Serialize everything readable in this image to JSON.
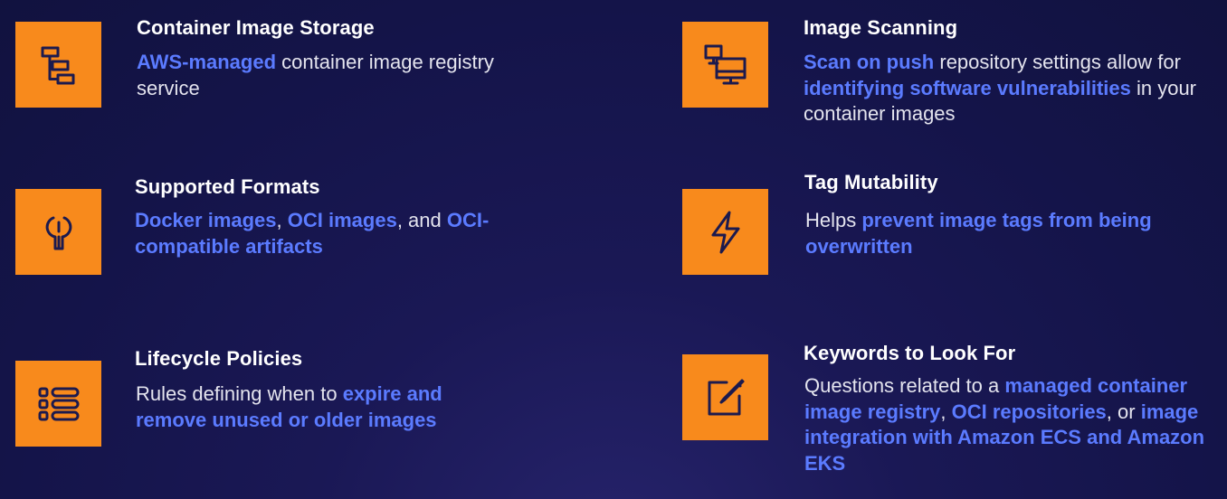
{
  "accent_color": "#5b7bff",
  "icon_bg_color": "#f88a1c",
  "features": [
    {
      "id": "container-image-storage",
      "icon": "registry-icon",
      "title": "Container Image Storage",
      "desc": [
        {
          "t": "AWS-managed",
          "hl": true
        },
        {
          "t": " container image registry service",
          "hl": false
        }
      ]
    },
    {
      "id": "image-scanning",
      "icon": "monitor-scan-icon",
      "title": "Image Scanning",
      "desc": [
        {
          "t": "Scan on push",
          "hl": true
        },
        {
          "t": " repository settings allow for ",
          "hl": false
        },
        {
          "t": "identifying software vulnerabilities",
          "hl": true
        },
        {
          "t": " in your container images",
          "hl": false
        }
      ]
    },
    {
      "id": "supported-formats",
      "icon": "wrench-icon",
      "title": "Supported Formats",
      "desc": [
        {
          "t": "Docker images",
          "hl": true
        },
        {
          "t": ", ",
          "hl": false
        },
        {
          "t": "OCI images",
          "hl": true
        },
        {
          "t": ", and ",
          "hl": false
        },
        {
          "t": "OCI-compatible artifacts",
          "hl": true
        }
      ]
    },
    {
      "id": "tag-mutability",
      "icon": "lightning-icon",
      "title": "Tag Mutability",
      "desc": [
        {
          "t": "Helps ",
          "hl": false
        },
        {
          "t": "prevent image tags from being overwritten",
          "hl": true
        }
      ]
    },
    {
      "id": "lifecycle-policies",
      "icon": "list-icon",
      "title": "Lifecycle Policies",
      "desc": [
        {
          "t": "Rules defining when to ",
          "hl": false
        },
        {
          "t": "expire and remove unused or older images",
          "hl": true
        }
      ]
    },
    {
      "id": "keywords",
      "icon": "edit-icon",
      "title": "Keywords to Look For",
      "desc": [
        {
          "t": "Questions related to a ",
          "hl": false
        },
        {
          "t": "managed container image registry",
          "hl": true
        },
        {
          "t": ", ",
          "hl": false
        },
        {
          "t": "OCI repositories",
          "hl": true
        },
        {
          "t": ", or ",
          "hl": false
        },
        {
          "t": "image integration with Amazon ECS and Amazon EKS",
          "hl": true
        }
      ]
    }
  ]
}
